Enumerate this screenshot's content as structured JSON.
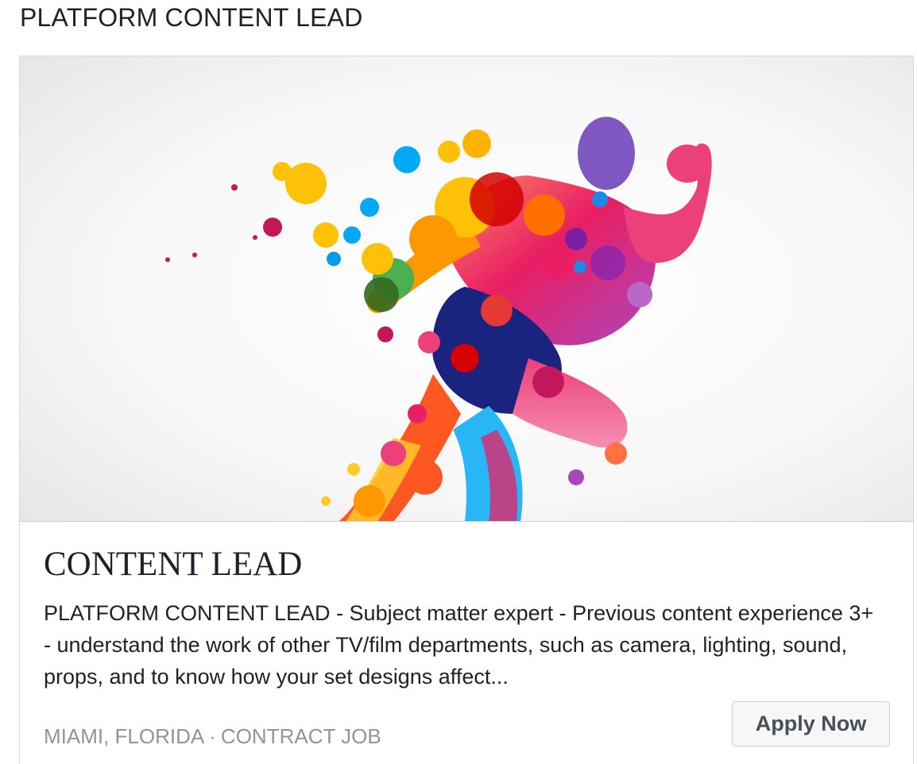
{
  "page": {
    "heading": "PLATFORM CONTENT LEAD"
  },
  "card": {
    "image": {
      "subject": "watercolor-splash-running-figure",
      "colors": [
        "#e91e63",
        "#ffc107",
        "#ff9800",
        "#2196f3",
        "#7b1fa2",
        "#d50000",
        "#1a237e",
        "#4caf50"
      ]
    },
    "title": "CONTENT LEAD",
    "description": "PLATFORM CONTENT LEAD - Subject matter expert - Previous content experience 3+ - understand the work of other TV/film departments, such as camera, lighting, sound, props, and to know how your set designs affect...",
    "location": "MIAMI, FLORIDA",
    "separator": "·",
    "job_type": "CONTRACT JOB",
    "apply_label": "Apply Now"
  },
  "colors": {
    "text_primary": "#1d2129",
    "text_meta": "#90949c",
    "button_bg": "#f6f7f9",
    "button_border": "#ccd0d5",
    "button_text": "#4b4f56",
    "card_border": "#d6d8db"
  }
}
